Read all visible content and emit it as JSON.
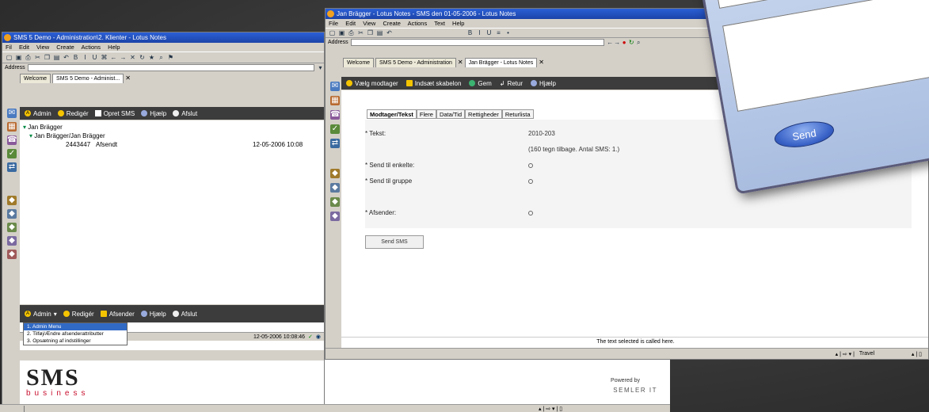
{
  "win1": {
    "title": "SMS 5 Demo - Administration\\2. Klienter - Lotus Notes",
    "menu": [
      "Fil",
      "Edit",
      "View",
      "Create",
      "Actions",
      "Help"
    ],
    "address_label": "Address",
    "tabs": [
      "Welcome",
      "SMS 5 Demo - Administ..."
    ],
    "actionbar": [
      "Admin",
      "Redigér",
      "Opret SMS",
      "Hjælp",
      "Afslut"
    ],
    "tree": {
      "level1": "Jan Brägger",
      "level2": "Jan Brägger/Jan Brägger",
      "row_number": "2443447",
      "row_label": "Afsendt",
      "row_date": "12-05-2006 10:08"
    },
    "bottombar": [
      "Admin",
      "Redigér",
      "Afsender",
      "Hjælp",
      "Afslut"
    ],
    "dropdown": [
      "1. Admin Menu",
      "2. Tilføj/Ændre afsenderattributter",
      "3. Opsætning af indstillinger"
    ],
    "status_text": "12-05-2006 10:08:46",
    "logo_text": "SMS",
    "logo_sub": "business",
    "powered_by": "Powered by",
    "powered_brand": "SEMLER IT"
  },
  "win2": {
    "title": "Jan Brägger - Lotus Notes - SMS den 01-05-2006 - Lotus Notes",
    "menu": [
      "File",
      "Edit",
      "View",
      "Create",
      "Actions",
      "Text",
      "Help"
    ],
    "address_label": "Address",
    "tabs": [
      "Welcome",
      "SMS 5 Demo - Administration",
      "Jan Brägger - Lotus Notes"
    ],
    "actionbar": [
      "Vælg modtager",
      "Indsæt skabelon",
      "Gem",
      "Retur",
      "Hjælp"
    ],
    "form_tabs": [
      "Modtager/Tekst",
      "Flere",
      "Data/Tid",
      "Rettigheder",
      "Returlista"
    ],
    "fields": {
      "tekst_label": "* Tekst:",
      "tekst_value": "2010-203",
      "tekst_note": "(160 tegn tilbage. Antal SMS: 1.)",
      "enkelte_label": "* Send til enkelte:",
      "gruppe_label": "* Send til gruppe",
      "afsender_label": "* Afsender:"
    },
    "send_button": "Send SMS",
    "status_message": "The text selected is called here.",
    "status_right": [
      "Travel"
    ]
  },
  "phone": {
    "send_label": "Send"
  },
  "colors": {
    "titlebar": "#2b5fd6",
    "actionbar": "#3c3c3c",
    "logo_red": "#c8102e",
    "phone_frame": "#b8c9e6",
    "send_button": "#3a63c8"
  }
}
